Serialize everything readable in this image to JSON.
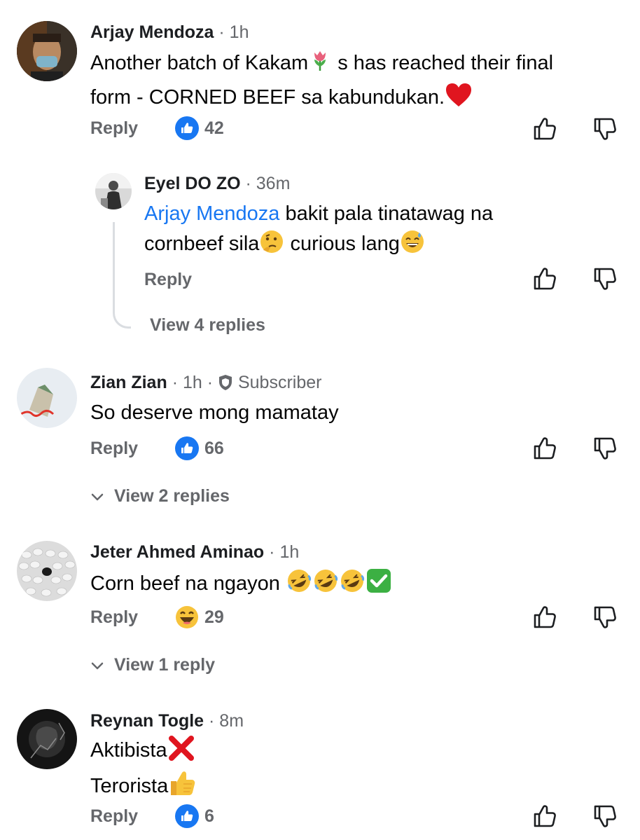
{
  "comments": [
    {
      "author": "Arjay Mendoza",
      "time": "1h",
      "text_part1": "Another batch of Kakam",
      "text_part2": " s has reached their final",
      "text_line2": "form - CORNED BEEF sa kabundukan.",
      "reply_label": "Reply",
      "reaction": "like",
      "reaction_count": "42"
    },
    {
      "author": "Eyel DO ZO",
      "time": "36m",
      "mention": "Arjay Mendoza",
      "text_part1": " bakit pala tinatawag na",
      "text_line2_a": "cornbeef sila",
      "text_line2_b": " curious lang",
      "reply_label": "Reply",
      "view_replies": "View 4 replies"
    },
    {
      "author": "Zian Zian",
      "time": "1h",
      "badge": "Subscriber",
      "text": "So deserve mong mamatay",
      "reply_label": "Reply",
      "reaction": "like",
      "reaction_count": "66",
      "view_replies": "View 2 replies"
    },
    {
      "author": "Jeter Ahmed Aminao",
      "time": "1h",
      "text": "Corn beef na ngayon ",
      "reply_label": "Reply",
      "reaction": "haha",
      "reaction_count": "29",
      "view_replies": "View 1 reply"
    },
    {
      "author": "Reynan Togle",
      "time": "8m",
      "text_line1": "Aktibista",
      "text_line2": "Terorista",
      "reply_label": "Reply",
      "reaction": "like",
      "reaction_count": "6"
    }
  ],
  "separator": "·",
  "colors": {
    "accent": "#1877f2",
    "meta": "#65676b",
    "text": "#050505"
  }
}
